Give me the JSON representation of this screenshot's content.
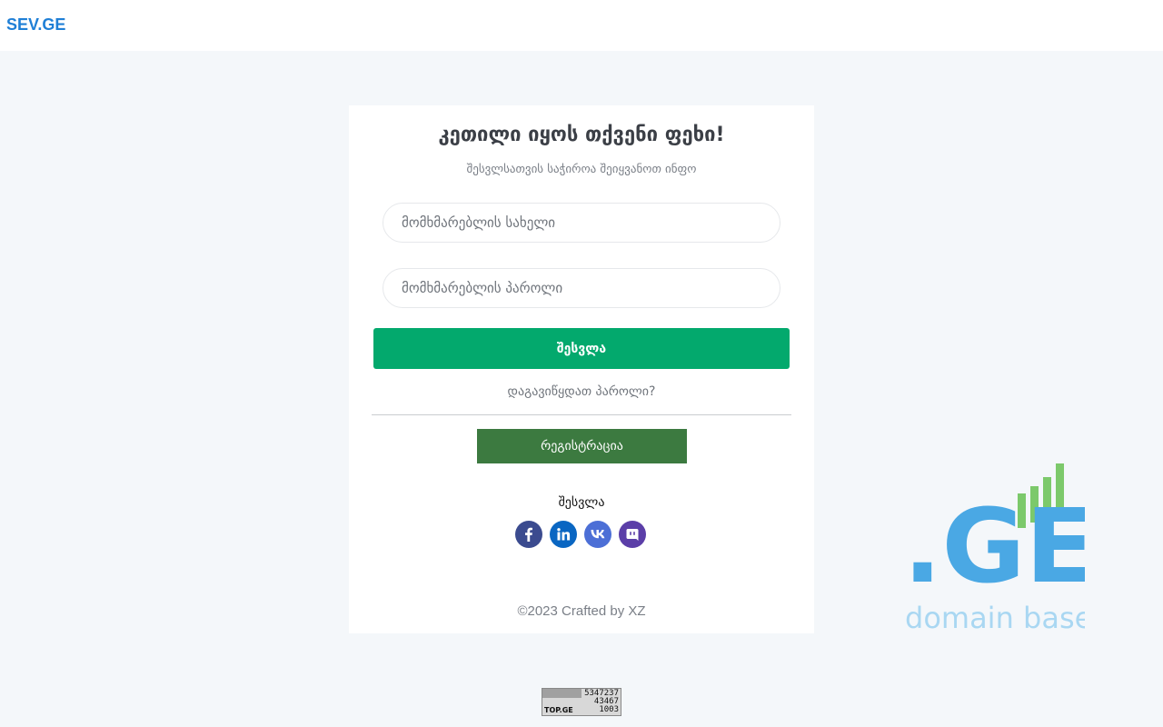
{
  "header": {
    "brand": "SEV.GE"
  },
  "login": {
    "title": "კეთილი იყოს თქვენი ფეხი!",
    "subtitle": "შესვლსათვის საჭიროა შეიყვანოთ ინფო",
    "username_placeholder": "მომხმარებლის სახელი",
    "password_placeholder": "მომხმარებლის პაროლი",
    "submit_label": "შესვლა",
    "forgot_label": "დაგავიწყდათ პაროლი?",
    "register_label": "რეგისტრაცია",
    "social_label": "შესვლა",
    "social": [
      {
        "icon": "facebook-icon",
        "color": "#3b4b8f"
      },
      {
        "icon": "linkedin-icon",
        "color": "#0a66c2"
      },
      {
        "icon": "vk-icon",
        "color": "#4c6fd6"
      },
      {
        "icon": "discord-icon",
        "color": "#5b3ea8"
      }
    ],
    "footer": "©2023 Crafted by XZ"
  },
  "logo": {
    "text": ".GE",
    "tagline": "domain base"
  },
  "counter": {
    "label": "TOP.GE",
    "values": [
      "5347237",
      "43467",
      "1003"
    ]
  },
  "colors": {
    "brand": "#1f7fd6",
    "login_button": "#03a96d",
    "register_button": "#3c7a40",
    "background": "#f4f7fa"
  }
}
